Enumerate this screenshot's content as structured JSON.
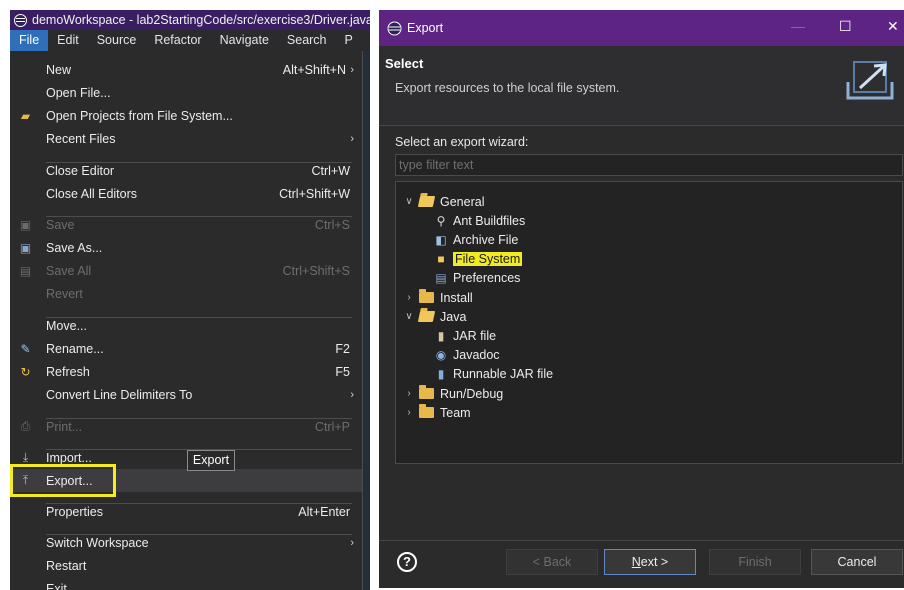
{
  "ide": {
    "title": "demoWorkspace - lab2StartingCode/src/exercise3/Driver.java",
    "menubar": [
      "File",
      "Edit",
      "Source",
      "Refactor",
      "Navigate",
      "Search",
      "P"
    ],
    "file_menu": {
      "items": [
        {
          "label": "New",
          "accel": "Alt+Shift+N",
          "arrow": "›"
        },
        {
          "label": "Open File..."
        },
        {
          "label": "Open Projects from File System...",
          "icon": "open-projects-icon"
        },
        {
          "label": "Recent Files",
          "arrow": "›"
        },
        {
          "label": "Close Editor",
          "accel": "Ctrl+W"
        },
        {
          "label": "Close All Editors",
          "accel": "Ctrl+Shift+W"
        },
        {
          "label": "Save",
          "accel": "Ctrl+S",
          "disabled": true,
          "icon": "save-icon"
        },
        {
          "label": "Save As...",
          "icon": "save-as-icon"
        },
        {
          "label": "Save All",
          "accel": "Ctrl+Shift+S",
          "disabled": true,
          "icon": "save-all-icon"
        },
        {
          "label": "Revert",
          "disabled": true
        },
        {
          "label": "Move..."
        },
        {
          "label": "Rename...",
          "accel": "F2",
          "icon": "rename-icon"
        },
        {
          "label": "Refresh",
          "accel": "F5",
          "icon": "refresh-icon"
        },
        {
          "label": "Convert Line Delimiters To",
          "arrow": "›"
        },
        {
          "label": "Print...",
          "accel": "Ctrl+P",
          "disabled": true,
          "icon": "print-icon"
        },
        {
          "label": "Import...",
          "icon": "import-icon"
        },
        {
          "label": "Export...",
          "icon": "export-icon",
          "hover": true
        },
        {
          "label": "Properties",
          "accel": "Alt+Enter"
        },
        {
          "label": "Switch Workspace",
          "arrow": "›"
        },
        {
          "label": "Restart"
        },
        {
          "label": "Exit"
        }
      ]
    },
    "tooltip": "Export"
  },
  "dialog": {
    "title": "Export",
    "header_title": "Select",
    "header_desc": "Export resources to the local file system.",
    "wizard_label": "Select an export wizard:",
    "filter_placeholder": "type filter text",
    "tree": [
      {
        "label": "General",
        "type": "folder",
        "expanded": true,
        "depth": 0
      },
      {
        "label": "Ant Buildfiles",
        "type": "leaf",
        "icon": "ant-icon",
        "depth": 1
      },
      {
        "label": "Archive File",
        "type": "leaf",
        "icon": "archive-icon",
        "depth": 1
      },
      {
        "label": "File System",
        "type": "leaf",
        "icon": "folder-icon",
        "depth": 1,
        "highlight": true
      },
      {
        "label": "Preferences",
        "type": "leaf",
        "icon": "preferences-icon",
        "depth": 1
      },
      {
        "label": "Install",
        "type": "folder",
        "expanded": false,
        "depth": 0
      },
      {
        "label": "Java",
        "type": "folder",
        "expanded": true,
        "depth": 0
      },
      {
        "label": "JAR file",
        "type": "leaf",
        "icon": "jar-icon",
        "depth": 1
      },
      {
        "label": "Javadoc",
        "type": "leaf",
        "icon": "javadoc-icon",
        "depth": 1
      },
      {
        "label": "Runnable JAR file",
        "type": "leaf",
        "icon": "runnable-jar-icon",
        "depth": 1
      },
      {
        "label": "Run/Debug",
        "type": "folder",
        "expanded": false,
        "depth": 0
      },
      {
        "label": "Team",
        "type": "folder",
        "expanded": false,
        "depth": 0
      }
    ],
    "buttons": {
      "back": "< Back",
      "next_mnemonic": "N",
      "next_rest": "ext >",
      "finish": "Finish",
      "cancel": "Cancel"
    },
    "help": "?"
  },
  "colors": {
    "ide_title_bar": "#3a1e63",
    "dialog_title_bar": "#5d2483",
    "highlight": "#f4ec21",
    "menu_active": "#2f6fba"
  }
}
